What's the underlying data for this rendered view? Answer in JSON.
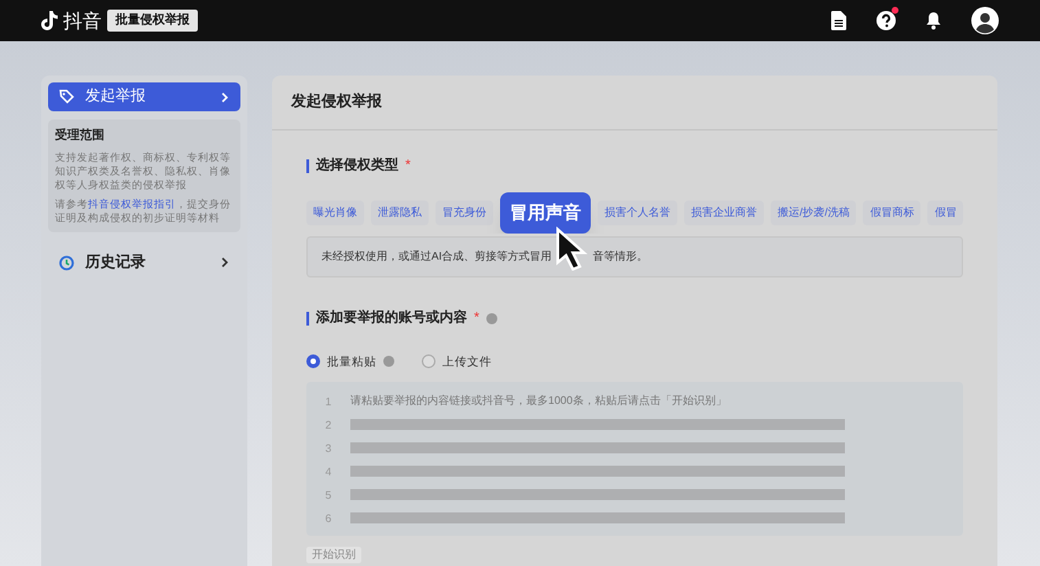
{
  "top_bar": {
    "brand": "抖音",
    "tag": "批量侵权举报",
    "help_badge": true
  },
  "sidebar": {
    "items": [
      {
        "label": "发起举报",
        "selected": true
      },
      {
        "label": "历史记录",
        "selected": false
      }
    ],
    "info_card": {
      "title": "受理范围",
      "paragraphs": [
        {
          "text": "支持发起著作权、商标权、专利权等知识产权类及名誉权、隐私权、肖像权等人身权益类的侵权举报"
        },
        {
          "text": "请参考",
          "link": "抖音侵权举报指引",
          "after": "，提交身份证明及构成侵权的初步证明等材料"
        }
      ]
    }
  },
  "main": {
    "title": "发起侵权举报",
    "section_1": {
      "title": "选择侵权类型",
      "required_mark": "*",
      "types": [
        {
          "label": "曝光肖像",
          "selected": false
        },
        {
          "label": "泄露隐私",
          "selected": false
        },
        {
          "label": "冒充身份",
          "selected": false
        },
        {
          "label": "冒用声音",
          "selected": true
        },
        {
          "label": "损害个人名誉",
          "selected": false
        },
        {
          "label": "损害企业商誉",
          "selected": false
        },
        {
          "label": "搬运/抄袭/洗稿",
          "selected": false
        },
        {
          "label": "假冒商标",
          "selected": false
        },
        {
          "label": "假冒",
          "selected": false
        }
      ],
      "description": [
        "未经授权使用，或通过AI合成、剪接等方式冒用",
        "音等情形。"
      ]
    },
    "section_2": {
      "title": "添加要举报的账号或内容",
      "required_mark": "*",
      "options": [
        {
          "label": "批量粘贴",
          "selected": true,
          "help": true
        },
        {
          "label": "上传文件",
          "selected": false
        }
      ],
      "editor": {
        "line_numbers": [
          "1",
          "2",
          "3",
          "4",
          "5",
          "6"
        ],
        "placeholder": "请粘贴要举报的内容链接或抖音号，最多1000条，粘贴后请点击「开始识别」"
      }
    },
    "button": "开始识别"
  }
}
